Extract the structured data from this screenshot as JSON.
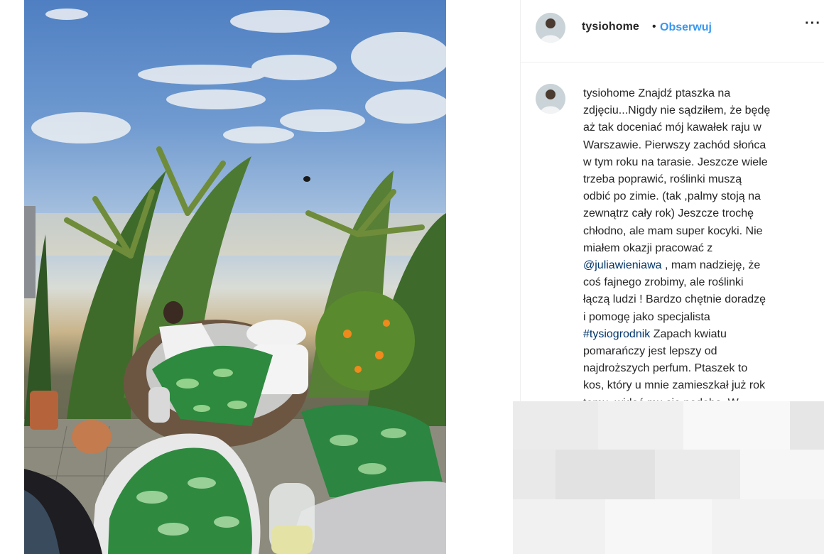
{
  "post": {
    "username": "tysiohome",
    "separator": "•",
    "follow_label": "Obserwuj",
    "more_label": "···"
  },
  "caption": {
    "lines": [
      {
        "pre": "tysiohome Znajdź ptaszka na",
        "link": "",
        "post": ""
      },
      {
        "pre": "zdjęciu...Nigdy nie sądziłem, że będę",
        "link": "",
        "post": ""
      },
      {
        "pre": "aż tak doceniać mój kawałek raju w",
        "link": "",
        "post": ""
      },
      {
        "pre": "Warszawie. Pierwszy zachód słońca",
        "link": "",
        "post": ""
      },
      {
        "pre": "w tym roku na tarasie. Jeszcze wiele",
        "link": "",
        "post": ""
      },
      {
        "pre": "trzeba poprawić, roślinki muszą",
        "link": "",
        "post": ""
      },
      {
        "pre": "odbić po zimie. (tak ,palmy stoją na",
        "link": "",
        "post": ""
      },
      {
        "pre": "zewnątrz cały rok) Jeszcze trochę",
        "link": "",
        "post": ""
      },
      {
        "pre": "chłodno, ale mam super kocyki. Nie",
        "link": "",
        "post": ""
      },
      {
        "pre": "miałem okazji pracować z",
        "link": "",
        "post": ""
      },
      {
        "pre": "",
        "link": "@juliawieniawa",
        "post": " , mam nadzieję, że"
      },
      {
        "pre": "coś fajnego zrobimy, ale roślinki",
        "link": "",
        "post": ""
      },
      {
        "pre": "łączą ludzi ! Bardzo chętnie doradzę",
        "link": "",
        "post": ""
      },
      {
        "pre": "i pomogę jako specjalista",
        "link": "",
        "post": ""
      },
      {
        "pre": "",
        "link": "#tysiogrodnik",
        "post": " Zapach kwiatu"
      },
      {
        "pre": "pomarańczy jest lepszy od",
        "link": "",
        "post": ""
      },
      {
        "pre": "najdroższych perfum. Ptaszek to",
        "link": "",
        "post": ""
      },
      {
        "pre": "kos, który u mnie zamieszkał już rok",
        "link": "",
        "post": ""
      },
      {
        "pre": "temu, widać mu się podoba. W",
        "link": "",
        "post": ""
      }
    ]
  },
  "colors": {
    "link": "#003569",
    "follow": "#3897f0",
    "text": "#262626"
  },
  "icons": {
    "avatar": "profile-avatar",
    "more": "more-options-icon"
  }
}
